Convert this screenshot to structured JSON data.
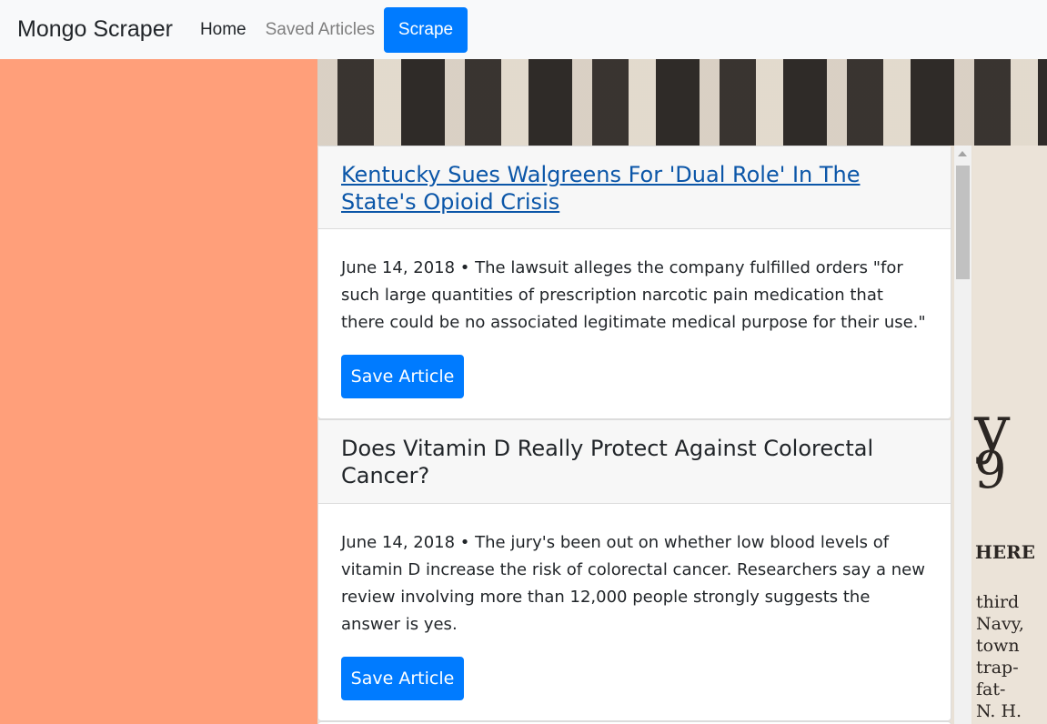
{
  "navbar": {
    "brand": "Mongo Scraper",
    "home": "Home",
    "saved": "Saved Articles",
    "scrape": "Scrape"
  },
  "articles": [
    {
      "title": "Kentucky Sues Walgreens For 'Dual Role' In The State's Opioid Crisis",
      "summary": "June 14, 2018 • The lawsuit alleges the company fulfilled orders \"for such large quantities of prescription narcotic pain medication that there could be no associated legitimate medical purpose for their use.\"",
      "button": "Save Article"
    },
    {
      "title": "Does Vitamin D Really Protect Against Colorectal Cancer?",
      "summary": "June 14, 2018 • The jury's been out on whether low blood levels of vitamin D increase the risk of colorectal cancer. Researchers say a new review involving more than 12,000 people strongly suggests the answer is yes.",
      "button": "Save Article"
    }
  ],
  "background": {
    "glyph_9": "9",
    "glyph_y": "y",
    "heading_fragment": "HERE",
    "text_lines": [
      "third",
      "Navy,",
      "town",
      "trap-",
      "fat-",
      "N. H."
    ]
  },
  "colors": {
    "accent": "#007bff",
    "left_panel": "#ff9f7a",
    "link": "#0b56a8"
  }
}
